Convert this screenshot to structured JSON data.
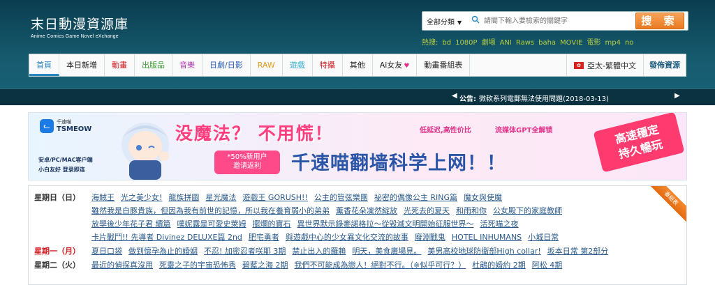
{
  "header": {
    "logo_title": "末日動漫資源庫",
    "logo_subtitle": "Anime Comics Game Novel eXchange",
    "search": {
      "category": "全部分類",
      "placeholder": "請閣下輸入要檢索的關鍵字",
      "button": "搜 索"
    },
    "hot_label": "熱搜:",
    "hot_keywords": [
      "bd",
      "1080P",
      "劇場",
      "ANI",
      "Raws",
      "baha",
      "MOVIE",
      "電影",
      "mp4",
      "no"
    ]
  },
  "nav": {
    "items": [
      {
        "label": "首頁",
        "color": "#2a86c0"
      },
      {
        "label": "本日新增",
        "color": "#222222"
      },
      {
        "label": "動畫",
        "color": "#d4181e"
      },
      {
        "label": "出版品",
        "color": "#39a033"
      },
      {
        "label": "音樂",
        "color": "#b43cb4"
      },
      {
        "label": "日劇/日影",
        "color": "#2a5fb5"
      },
      {
        "label": "RAW",
        "color": "#e39b1c"
      },
      {
        "label": "遊戲",
        "color": "#35b0d2"
      },
      {
        "label": "特攝",
        "color": "#d4181e"
      },
      {
        "label": "其他",
        "color": "#222222"
      },
      {
        "label": "Ai女友",
        "color": "#222222"
      },
      {
        "label": "動畫番組表",
        "color": "#222222"
      }
    ],
    "region": "亞太-繁體中文",
    "publish": "發佈資源"
  },
  "announcement": {
    "label": "公告:",
    "text": "微軟系列電郵無法使用問題(2018-03-13)"
  },
  "banner": {
    "brand_small": "千速喵",
    "brand": "TSMEOW",
    "sub1": "安卓/PC/MAC客户端",
    "sub2": "小白友好 登录即连",
    "headline": "没魔法？ 不用慌！",
    "tag1": "低延迟,高性价比",
    "tag2": "流媒体GPT全解锁",
    "pill": "*50%新用户\n邀请返利",
    "main": "千速喵翻墙科学上网！！",
    "badge": "高速穩定\n持久暢玩"
  },
  "schedule": {
    "corner": "番組表",
    "rows": [
      {
        "day": "星期日（日）",
        "highlight": false,
        "titles": [
          "海賊王",
          "光之美少女!",
          "龍族拼圖",
          "星光魔法",
          "遊戲王 GORUSH!!",
          "公主的管弦樂團",
          "祕密的偶像公主 RING篇",
          "魔女與使魔"
        ]
      },
      {
        "day": "",
        "highlight": false,
        "titles": [
          "雖然我是白豚貴族，但因為我有前世的記憶，所以我在養育弱小的弟弟",
          "薰香花朵凜然綻放",
          "光死去的夏天",
          "和雨和你",
          "公女殿下的家庭教師"
        ]
      },
      {
        "day": "",
        "highlight": false,
        "titles": [
          "放學後少年花子君 續篇",
          "噗妮露是可愛史萊姆",
          "擺爛的寶石",
          "異世界默示錄麥諾格拉～從毀滅文明開始征服世界～",
          "活死喵之夜"
        ]
      },
      {
        "day": "",
        "highlight": false,
        "titles": [
          "卡片戰鬥!! 先導者 Divinez DELUXE篇 2nd",
          "肥宅勇者",
          "與遊戲中心的少女異文化交流的故事",
          "廢淵戰鬼",
          "HOTEL INHUMANS",
          "小城日常"
        ]
      },
      {
        "day": "星期一（月）",
        "highlight": true,
        "titles": [
          "夏日口袋",
          "做到懷孕為止的婚姻",
          "不忍! 加密忍者咲耶 3期",
          "禁止出入的羅賴",
          "明天，美食廣場見。",
          "美男高校地球防衛部High collar!",
          "坂本日常 第2部分"
        ]
      },
      {
        "day": "星期二（火）",
        "highlight": false,
        "titles": [
          "最近的偵探真沒用",
          "死靈之子的宇宙恐怖秀",
          "碧藍之海 2期",
          "我們不可能成為戀人！絕對不行。（※似乎可行？）",
          "杜鵑的婚約 2期",
          "阿松 4期"
        ]
      }
    ]
  }
}
